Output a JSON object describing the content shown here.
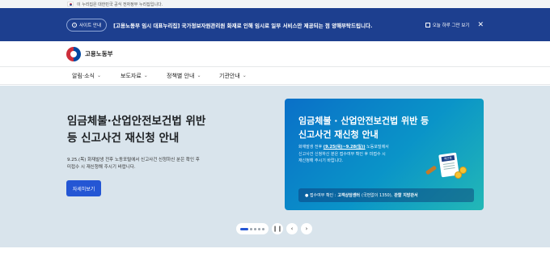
{
  "gov_bar": {
    "text": "이 누리집은 대한민국 공식 전자정부 누리집입니다."
  },
  "notice": {
    "badge": "사이트 안내",
    "text": "[고용노동부 임시 대표누리집] 국가정보자원관리원 화재로 인해 임시로 일부 서비스만 제공되는 점 양해부탁드립니다.",
    "checkbox_label": "오늘 하루 그만 보기",
    "close": "✕"
  },
  "header": {
    "logo_text": "고용노동부"
  },
  "nav": {
    "items": [
      {
        "label": "알림·소식"
      },
      {
        "label": "보도자료"
      },
      {
        "label": "정책별 안내"
      },
      {
        "label": "기관안내"
      }
    ]
  },
  "hero": {
    "title_line1": "임금체불·산업안전보건법 위반",
    "title_line2": "등 신고사건 재신청 안내",
    "desc_line1": "9.25.(목) 화재발생 전후 노동포털에서 신고사건 신청하신 분은 확인 후",
    "desc_line2": "미접수 시 재신청해 주시기 바랍니다.",
    "button": "자세히보기"
  },
  "banner": {
    "title_line1": "임금체불 · 산업안전보건법 위반 등",
    "title_line2": "신고사건 재신청 안내",
    "desc_pre": "화재발생 전후",
    "desc_date": "(9.25(목)~9.28(일))",
    "desc_post": "노동포털에서",
    "desc_line2": "신고사건 신청하신 분은 접수여부 확인 후 미접수 시",
    "desc_line3": "재신청해 주시기 바랍니다.",
    "bar_pre": "● 접수여부 확인 :",
    "bar_center": "고객상담센터",
    "bar_center_detail": "(국번없이 1350),",
    "bar_office": "관할 지방관서",
    "board_label": "재신청"
  },
  "pager": {
    "pause": "❙❙",
    "prev": "‹",
    "next": "›"
  }
}
